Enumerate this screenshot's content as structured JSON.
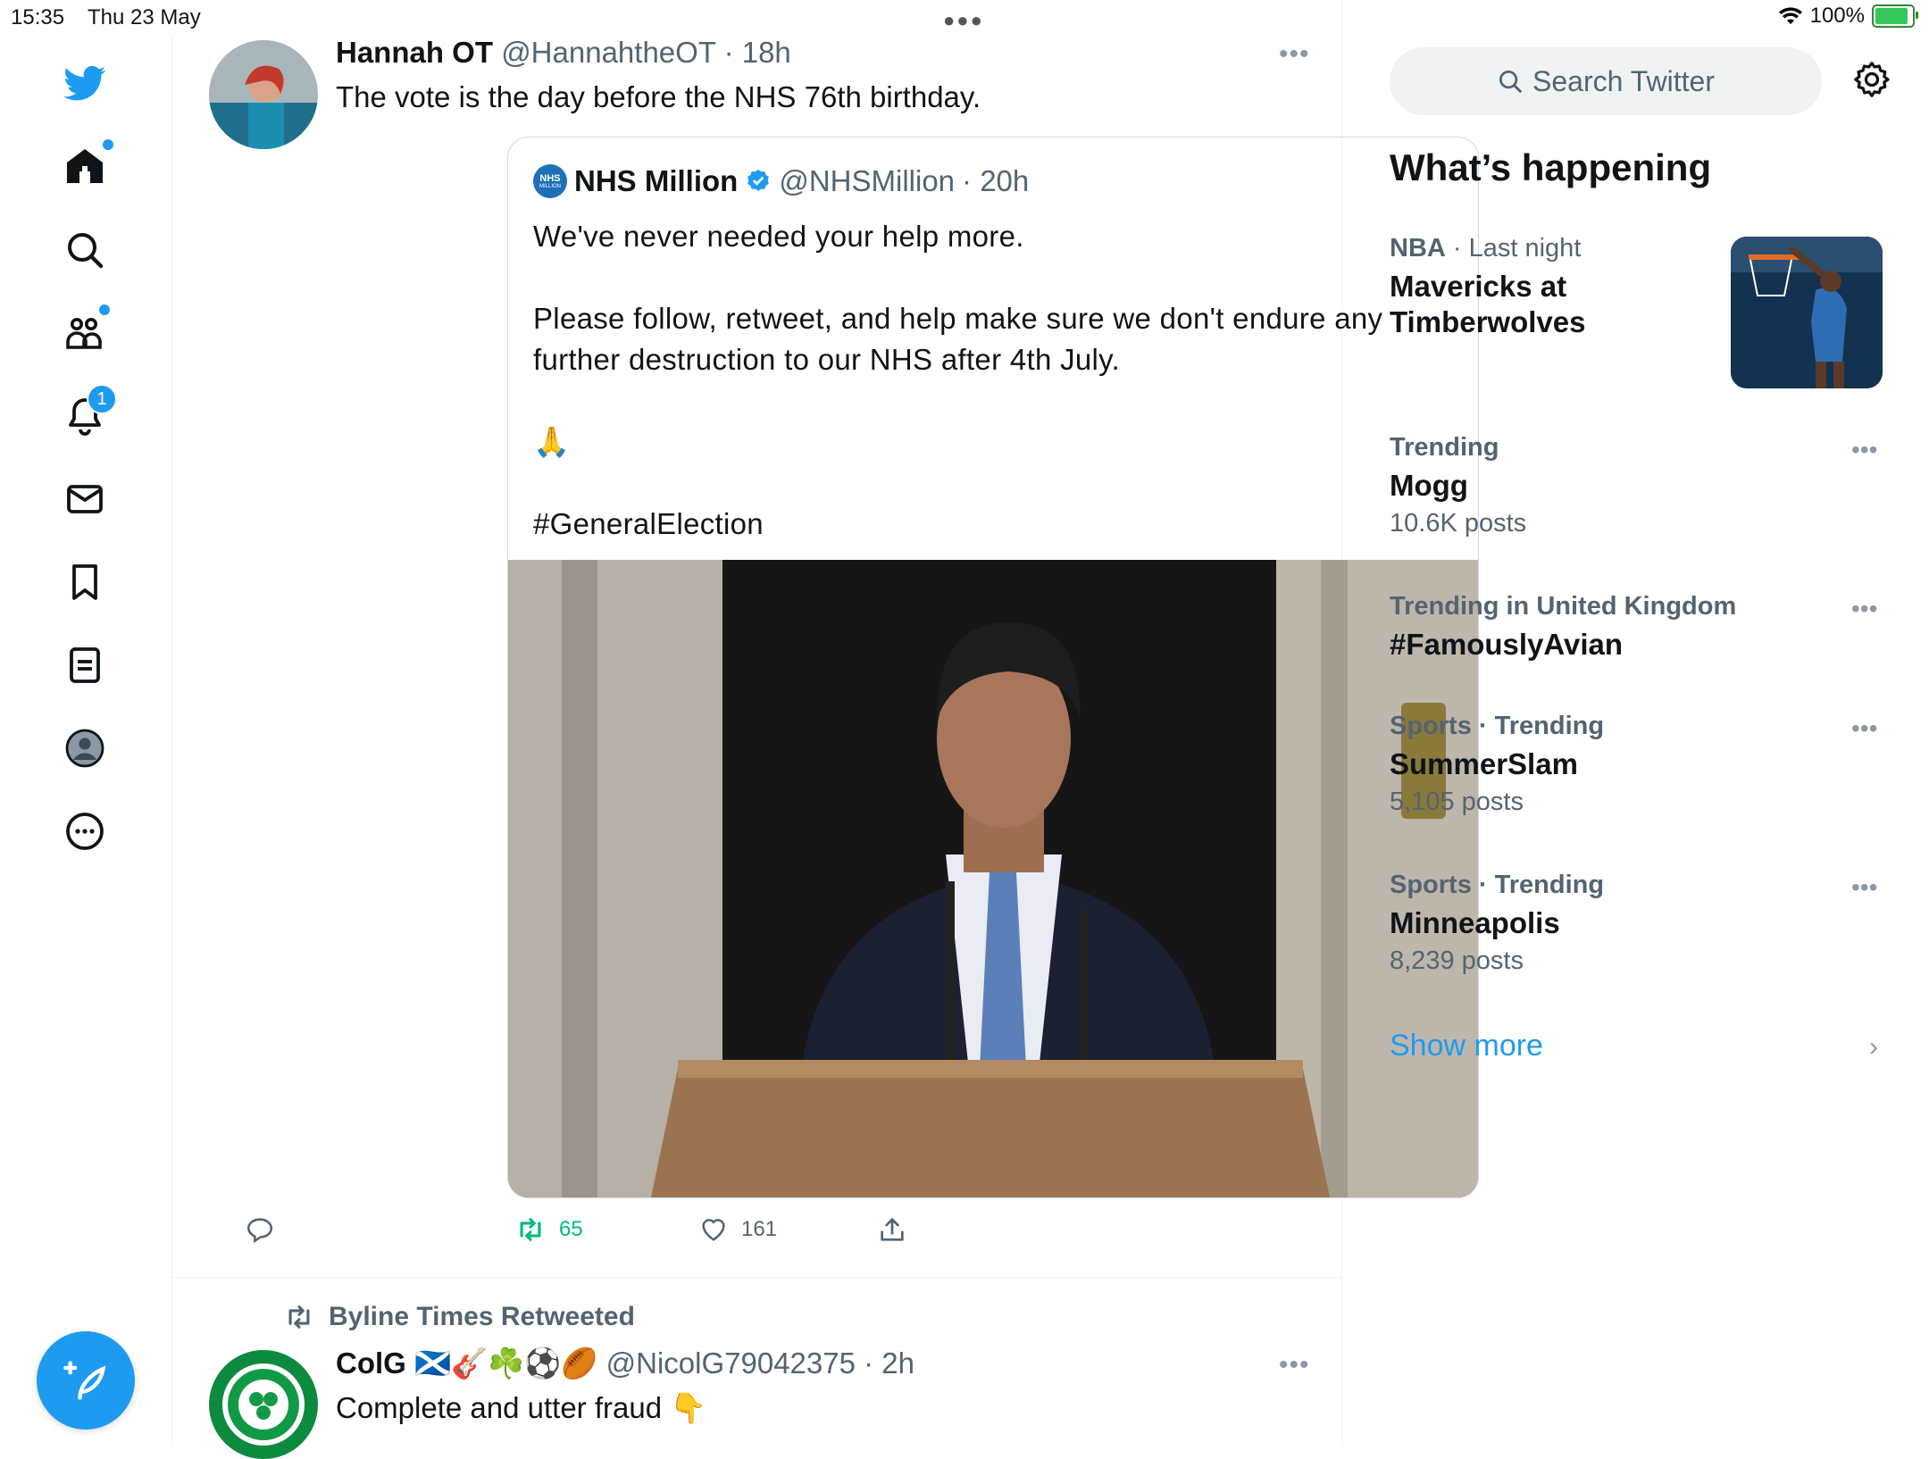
{
  "status_bar": {
    "time": "15:35",
    "date": "Thu 23 May",
    "battery_text": "100%",
    "battery_level": 1.0
  },
  "nav": {
    "notifications_count": "1",
    "icons": [
      "twitter-bird-icon",
      "home-icon",
      "search-icon",
      "communities-icon",
      "bell-icon",
      "mail-icon",
      "bookmark-icon",
      "lists-icon",
      "profile-icon",
      "more-icon",
      "compose-icon"
    ]
  },
  "tweets": [
    {
      "name": "Hannah OT",
      "handle": "@HannahtheOT",
      "time": "· 18h",
      "text": "The vote is the day before the NHS 76th birthday.",
      "quote": {
        "name": "NHS Million",
        "verified": true,
        "handle": "@NHSMillion",
        "time": "· 20h",
        "logo_text": "NHS",
        "logo_subtext": "MILLION",
        "text": "We've never needed your help more.\n\nPlease follow, retweet, and help make sure we don't endure any further destruction to our NHS after 4th July.\n\n🙏\n\n#GeneralElection"
      },
      "retweets": "65",
      "likes": "161"
    },
    {
      "retweeted_by": "Byline Times Retweeted",
      "name": "ColG 🏴󠁧󠁢󠁳󠁣󠁴󠁿🎸☘️⚽🏉",
      "handle": "@NicolG79042375",
      "time": "· 2h",
      "text": "Complete and utter fraud 👇"
    }
  ],
  "right": {
    "search_placeholder": "Search Twitter",
    "heading": "What’s happening",
    "trends": [
      {
        "meta_bold": "NBA",
        "meta_rest": " · Last night",
        "title": "Mavericks at Timberwolves",
        "count": ""
      },
      {
        "meta_bold": "",
        "meta_rest": "Trending",
        "title": "Mogg",
        "count": "10.6K posts"
      },
      {
        "meta_bold": "",
        "meta_rest": "Trending in United Kingdom",
        "title": "#FamouslyAvian",
        "count": ""
      },
      {
        "meta_bold": "",
        "meta_rest": "Sports · Trending",
        "title": "SummerSlam",
        "count": "5,105 posts"
      },
      {
        "meta_bold": "",
        "meta_rest": "Sports · Trending",
        "title": "Minneapolis",
        "count": "8,239 posts"
      }
    ],
    "show_more": "Show more"
  },
  "colors": {
    "accent": "#1d9bf0",
    "retweet_green": "#00ba7c",
    "muted": "#536471"
  }
}
